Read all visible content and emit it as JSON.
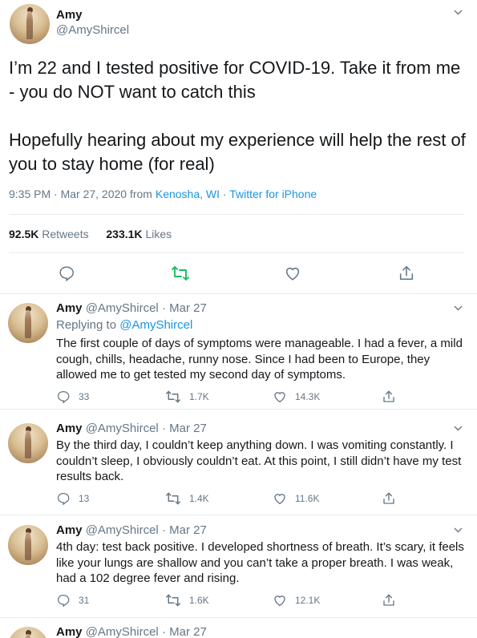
{
  "main": {
    "display_name": "Amy",
    "handle": "@AmyShircel",
    "text": "I’m 22 and I tested positive for COVID-19. Take it from me - you do NOT want to catch this\n\nHopefully hearing about my experience will help the rest of you to stay home (for real)",
    "time_date": "9:35 PM · Mar 27, 2020 from ",
    "location": "Kenosha, WI",
    "source_sep": " · ",
    "source": "Twitter for iPhone",
    "retweets_count": "92.5K",
    "retweets_label": "Retweets",
    "likes_count": "233.1K",
    "likes_label": "Likes",
    "retweet_color": "#17bf63"
  },
  "replies": [
    {
      "name": "Amy",
      "handle": "@AmyShircel",
      "date": "· Mar 27",
      "replying_to_label": "Replying to ",
      "replying_to": "@AmyShircel",
      "text": "The first couple of days of symptoms were manageable. I had a fever, a mild cough, chills, headache, runny nose. Since I had been to Europe, they allowed me to get tested my second day of symptoms.",
      "replies": "33",
      "retweets": "1.7K",
      "likes": "14.3K"
    },
    {
      "name": "Amy",
      "handle": "@AmyShircel",
      "date": "· Mar 27",
      "text": "By the third day, I couldn’t keep anything down. I was vomiting constantly. I couldn’t sleep, I obviously couldn’t eat. At this point, I still didn’t have my test results back.",
      "replies": "13",
      "retweets": "1.4K",
      "likes": "11.6K"
    },
    {
      "name": "Amy",
      "handle": "@AmyShircel",
      "date": "· Mar 27",
      "text": "4th day: test back positive. I developed shortness of breath. It’s scary, it feels like your lungs are shallow and you can’t take a proper breath. I was weak, had a 102 degree fever and rising.",
      "replies": "31",
      "retweets": "1.6K",
      "likes": "12.1K"
    },
    {
      "name": "Amy",
      "handle": "@AmyShircel",
      "date": "· Mar 27"
    }
  ]
}
